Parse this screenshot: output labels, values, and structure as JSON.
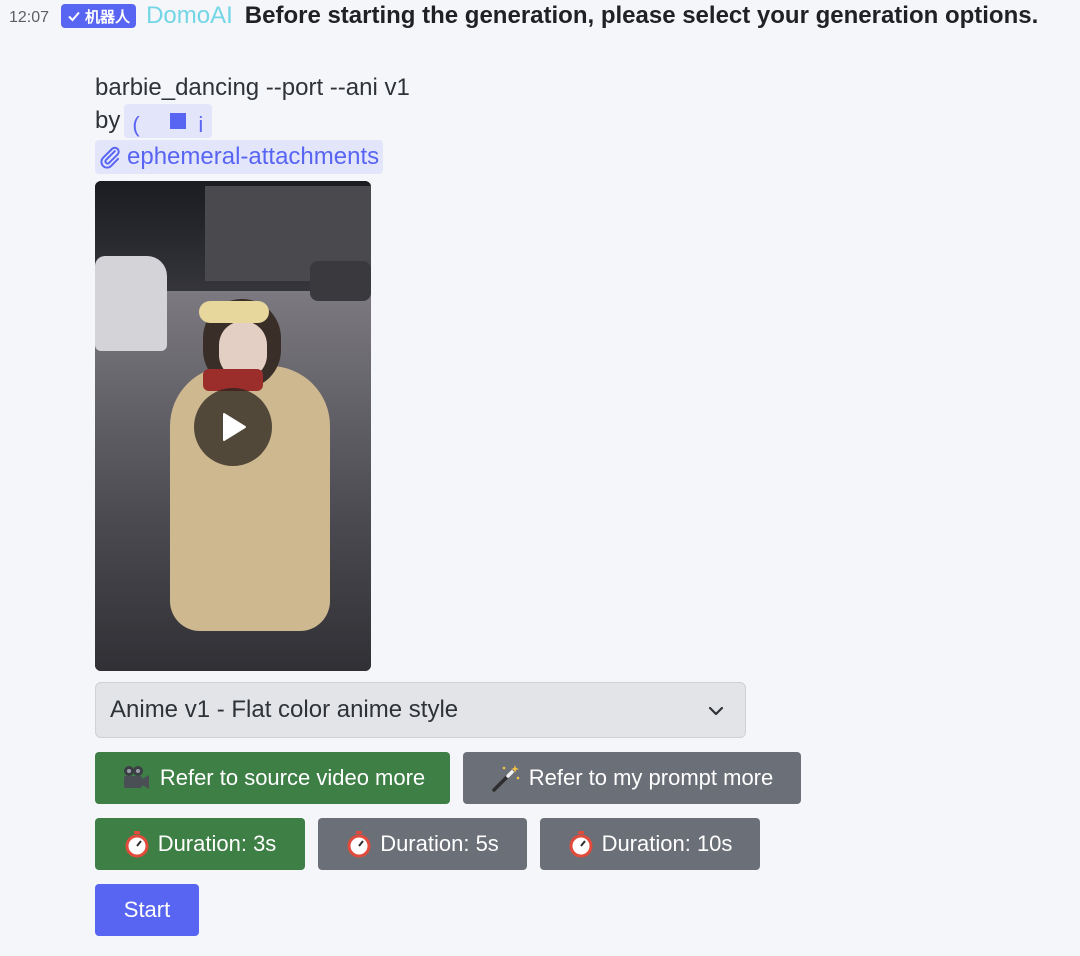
{
  "header": {
    "time": "12:07",
    "bot_tag": "机器人",
    "username": "DomoAI",
    "text": "Before starting the generation, please select your generation options."
  },
  "message": {
    "prompt": "barbie_dancing --port --ani v1",
    "by_label": "by",
    "mention_fragment_left": "(",
    "mention_fragment_right": "i",
    "channel": "ephemeral-attachments"
  },
  "style_select": {
    "selected": "Anime v1 - Flat color anime style"
  },
  "reference_buttons": [
    {
      "icon": "movie-camera-icon",
      "label": "Refer to source video more",
      "style": "green"
    },
    {
      "icon": "magic-wand-icon",
      "label": "Refer to my prompt more",
      "style": "grey"
    }
  ],
  "duration_buttons": [
    {
      "icon": "stopwatch-icon",
      "label": "Duration: 3s",
      "style": "green"
    },
    {
      "icon": "stopwatch-icon",
      "label": "Duration: 5s",
      "style": "grey"
    },
    {
      "icon": "stopwatch-icon",
      "label": "Duration: 10s",
      "style": "grey"
    }
  ],
  "start_button": {
    "label": "Start"
  },
  "colors": {
    "blurple": "#5865f2",
    "success_green": "#3e7f46",
    "secondary_grey": "#6b6f77",
    "username": "#72d6e6"
  }
}
